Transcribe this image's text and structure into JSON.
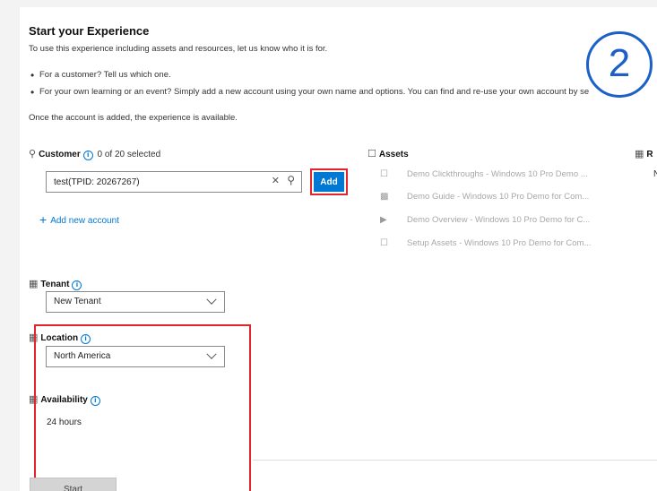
{
  "header": {
    "title": "Start your Experience",
    "intro": "To use this experience including assets and resources, let us know who it is for.",
    "bullets": [
      "For a customer? Tell us which one.",
      "For your own learning or an event? Simply add a new account using your own name and options. You can find and re-use your own account by se"
    ],
    "availability_note": "Once the account is added, the experience is available."
  },
  "customer": {
    "label": "Customer",
    "selected_count": "0 of 20 selected",
    "search_value": "test(TPID: 20267267)",
    "add_label": "Add",
    "add_new_label": "Add new account"
  },
  "assets": {
    "label": "Assets",
    "items": [
      "Demo Clickthroughs - Windows 10 Pro Demo ...",
      "Demo Guide - Windows 10 Pro Demo for Com...",
      "Demo Overview - Windows 10 Pro Demo for C...",
      "Setup Assets - Windows 10 Pro Demo for Com..."
    ]
  },
  "resources": {
    "label_partial": "R",
    "value_partial": "N"
  },
  "tenant": {
    "label": "Tenant",
    "value": "New Tenant"
  },
  "location": {
    "label": "Location",
    "value": "North America"
  },
  "availability": {
    "label": "Availability",
    "value": "24 hours"
  },
  "footer": {
    "start_label": "Start"
  },
  "step_marker": "2",
  "colors": {
    "accent": "#0078d4",
    "highlight": "#e3242b",
    "marker": "#1b5fc7"
  }
}
